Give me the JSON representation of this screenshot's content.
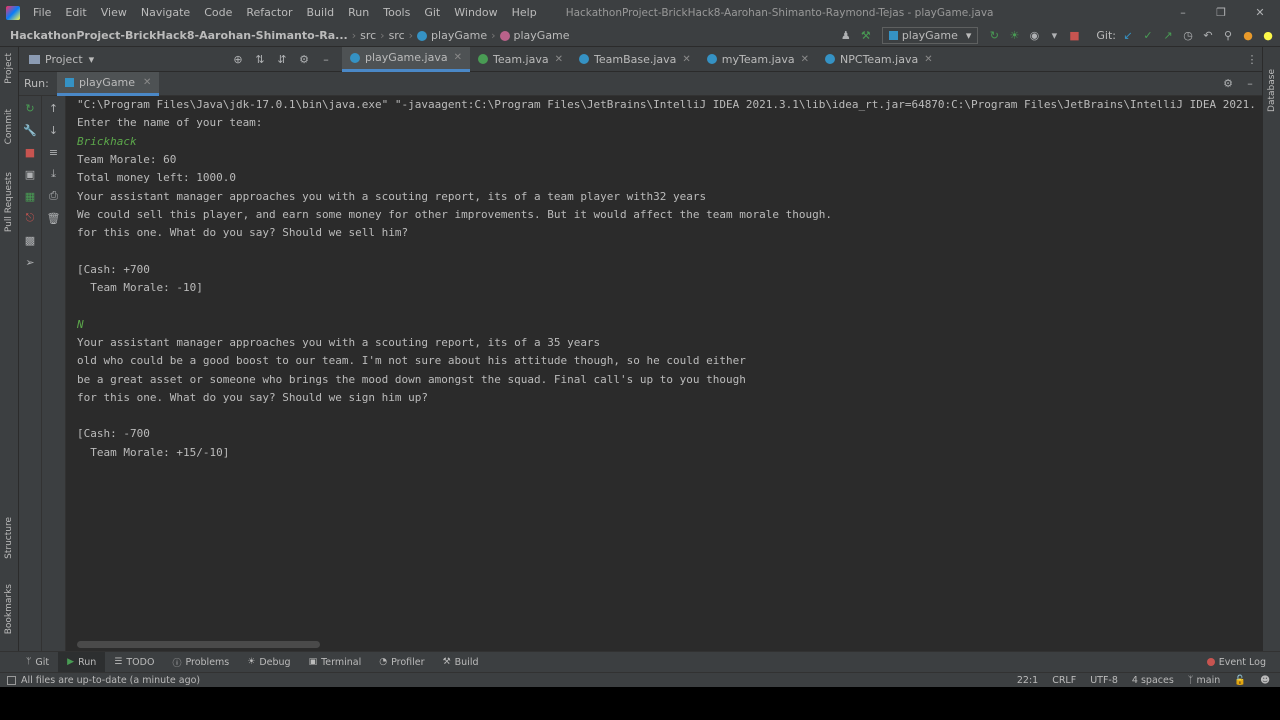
{
  "window": {
    "title": "HackathonProject-BrickHack8-Aarohan-Shimanto-Raymond-Tejas - playGame.java"
  },
  "menu": [
    "File",
    "Edit",
    "View",
    "Navigate",
    "Code",
    "Refactor",
    "Build",
    "Run",
    "Tools",
    "Git",
    "Window",
    "Help"
  ],
  "breadcrumb": {
    "project": "HackathonProject-BrickHack8-Aarohan-Shimanto-Ra...",
    "src1": "src",
    "src2": "src",
    "class1": "playGame",
    "class2": "playGame"
  },
  "run_config": "playGame",
  "git_label": "Git:",
  "project_panel": {
    "label": "Project"
  },
  "editor_tabs": [
    {
      "label": "playGame.java",
      "active": true
    },
    {
      "label": "Team.java",
      "active": false
    },
    {
      "label": "TeamBase.java",
      "active": false
    },
    {
      "label": "myTeam.java",
      "active": false
    },
    {
      "label": "NPCTeam.java",
      "active": false
    }
  ],
  "run_panel": {
    "label": "Run:",
    "tab": "playGame"
  },
  "console_lines": [
    {
      "text": "\"C:\\Program Files\\Java\\jdk-17.0.1\\bin\\java.exe\" \"-javaagent:C:\\Program Files\\JetBrains\\IntelliJ IDEA 2021.3.1\\lib\\idea_rt.jar=64870:C:\\Program Files\\JetBrains\\IntelliJ IDEA 2021.",
      "input": false
    },
    {
      "text": "Enter the name of your team:",
      "input": false
    },
    {
      "text": "Brickhack",
      "input": true
    },
    {
      "text": "Team Morale: 60",
      "input": false
    },
    {
      "text": "Total money left: 1000.0",
      "input": false
    },
    {
      "text": "Your assistant manager approaches you with a scouting report, its of a team player with32 years",
      "input": false
    },
    {
      "text": "We could sell this player, and earn some money for other improvements. But it would affect the team morale though.",
      "input": false
    },
    {
      "text": "for this one. What do you say? Should we sell him?",
      "input": false
    },
    {
      "text": "",
      "input": false
    },
    {
      "text": "[Cash: +700",
      "input": false
    },
    {
      "text": "  Team Morale: -10]",
      "input": false
    },
    {
      "text": "",
      "input": false
    },
    {
      "text": "N",
      "input": true
    },
    {
      "text": "Your assistant manager approaches you with a scouting report, its of a 35 years",
      "input": false
    },
    {
      "text": "old who could be a good boost to our team. I'm not sure about his attitude though, so he could either",
      "input": false
    },
    {
      "text": "be a great asset or someone who brings the mood down amongst the squad. Final call's up to you though",
      "input": false
    },
    {
      "text": "for this one. What do you say? Should we sign him up?",
      "input": false
    },
    {
      "text": "",
      "input": false
    },
    {
      "text": "[Cash: -700",
      "input": false
    },
    {
      "text": "  Team Morale: +15/-10]",
      "input": false
    }
  ],
  "side_labels": {
    "project": "Project",
    "commit": "Commit",
    "pull_requests": "Pull Requests",
    "structure": "Structure",
    "bookmarks": "Bookmarks",
    "database": "Database"
  },
  "bottom_tools": [
    {
      "label": "Git",
      "icon": "git-icon",
      "active": false
    },
    {
      "label": "Run",
      "icon": "run-icon",
      "active": true
    },
    {
      "label": "TODO",
      "icon": "todo-icon",
      "active": false
    },
    {
      "label": "Problems",
      "icon": "problems-icon",
      "active": false
    },
    {
      "label": "Debug",
      "icon": "debug-icon",
      "active": false
    },
    {
      "label": "Terminal",
      "icon": "terminal-icon",
      "active": false
    },
    {
      "label": "Profiler",
      "icon": "profiler-icon",
      "active": false
    },
    {
      "label": "Build",
      "icon": "build-icon",
      "active": false
    }
  ],
  "event_log": "Event Log",
  "status": {
    "message": "All files are up-to-date (a minute ago)",
    "position": "22:1",
    "line_sep": "CRLF",
    "encoding": "UTF-8",
    "indent": "4 spaces",
    "branch": "main"
  }
}
